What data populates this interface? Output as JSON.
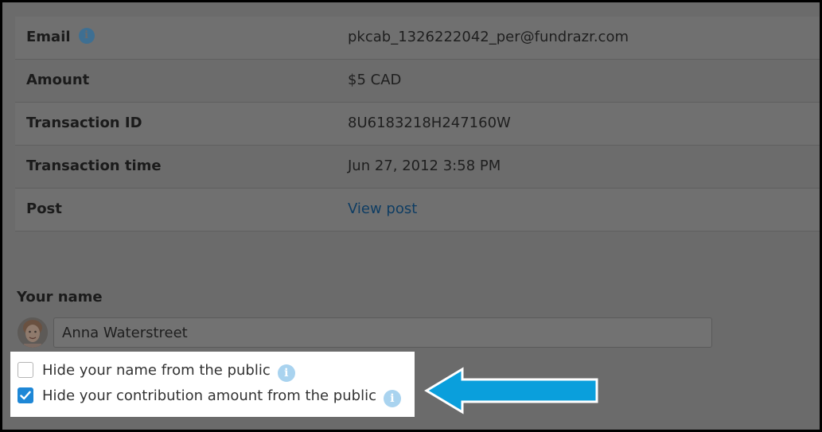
{
  "details": {
    "rows": [
      {
        "label": "Email",
        "value": "pkcab_1326222042_per@fundrazr.com"
      },
      {
        "label": "Amount",
        "value": "$5 CAD"
      },
      {
        "label": "Transaction ID",
        "value": "8U6183218H247160W"
      },
      {
        "label": "Transaction time",
        "value": "Jun 27, 2012 3:58 PM"
      },
      {
        "label": "Post",
        "value": "View post"
      }
    ],
    "email_info_icon": "i"
  },
  "name_section": {
    "label": "Your name",
    "name_value": "Anna Waterstreet"
  },
  "privacy": {
    "hide_name": {
      "label": "Hide your name from the public",
      "checked": false,
      "info_icon": "i"
    },
    "hide_amount": {
      "label": "Hide your contribution amount from the public",
      "checked": true,
      "info_icon": "i"
    }
  },
  "icons": {
    "info": "info-icon",
    "check": "checkmark-icon",
    "arrow": "arrow-left-icon",
    "avatar": "user-avatar"
  },
  "colors": {
    "overlay": "#6b6b6b",
    "checkbox_checked": "#1e87d6",
    "arrow": "#0a9fdc",
    "info_light": "#a9d3ef"
  }
}
